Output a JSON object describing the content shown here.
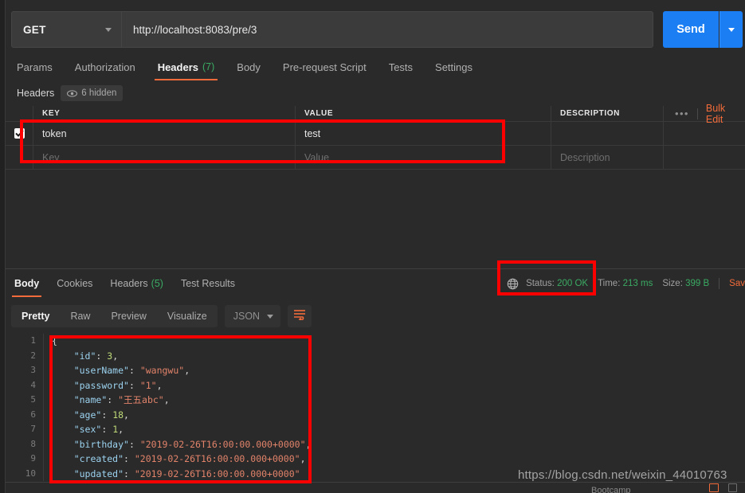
{
  "request": {
    "method": "GET",
    "url": "http://localhost:8083/pre/3",
    "send_label": "Send",
    "tabs": [
      {
        "label": "Params",
        "count": "",
        "active": false
      },
      {
        "label": "Authorization",
        "count": "",
        "active": false
      },
      {
        "label": "Headers",
        "count": "(7)",
        "active": true
      },
      {
        "label": "Body",
        "count": "",
        "active": false
      },
      {
        "label": "Pre-request Script",
        "count": "",
        "active": false
      },
      {
        "label": "Tests",
        "count": "",
        "active": false
      },
      {
        "label": "Settings",
        "count": "",
        "active": false
      }
    ],
    "headers_section": {
      "label": "Headers",
      "hidden_pill": "6 hidden",
      "columns": [
        "KEY",
        "VALUE",
        "DESCRIPTION"
      ],
      "bulk_edit_label": "Bulk Edit",
      "rows": [
        {
          "checked": true,
          "key": "token",
          "value": "test",
          "description": ""
        }
      ],
      "placeholder_row": {
        "key": "Key",
        "value": "Value",
        "description": "Description"
      }
    }
  },
  "response": {
    "tabs": [
      {
        "label": "Body",
        "count": "",
        "active": true
      },
      {
        "label": "Cookies",
        "count": "",
        "active": false
      },
      {
        "label": "Headers",
        "count": "(5)",
        "active": false
      },
      {
        "label": "Test Results",
        "count": "",
        "active": false
      }
    ],
    "status_label": "Status:",
    "status_value": "200 OK",
    "time_label": "Time:",
    "time_value": "213 ms",
    "size_label": "Size:",
    "size_value": "399 B",
    "save_label": "Sav",
    "format_tabs": [
      {
        "label": "Pretty",
        "active": true
      },
      {
        "label": "Raw",
        "active": false
      },
      {
        "label": "Preview",
        "active": false
      },
      {
        "label": "Visualize",
        "active": false
      }
    ],
    "format_select": "JSON",
    "body_lines": [
      {
        "no": "1",
        "segments": [
          {
            "t": "{",
            "c": "p"
          }
        ]
      },
      {
        "no": "2",
        "segments": [
          {
            "t": "    ",
            "c": "p"
          },
          {
            "t": "\"id\"",
            "c": "k"
          },
          {
            "t": ": ",
            "c": "p"
          },
          {
            "t": "3",
            "c": "n"
          },
          {
            "t": ",",
            "c": "p"
          }
        ]
      },
      {
        "no": "3",
        "segments": [
          {
            "t": "    ",
            "c": "p"
          },
          {
            "t": "\"userName\"",
            "c": "k"
          },
          {
            "t": ": ",
            "c": "p"
          },
          {
            "t": "\"wangwu\"",
            "c": "s"
          },
          {
            "t": ",",
            "c": "p"
          }
        ]
      },
      {
        "no": "4",
        "segments": [
          {
            "t": "    ",
            "c": "p"
          },
          {
            "t": "\"password\"",
            "c": "k"
          },
          {
            "t": ": ",
            "c": "p"
          },
          {
            "t": "\"1\"",
            "c": "s"
          },
          {
            "t": ",",
            "c": "p"
          }
        ]
      },
      {
        "no": "5",
        "segments": [
          {
            "t": "    ",
            "c": "p"
          },
          {
            "t": "\"name\"",
            "c": "k"
          },
          {
            "t": ": ",
            "c": "p"
          },
          {
            "t": "\"王五abc\"",
            "c": "s"
          },
          {
            "t": ",",
            "c": "p"
          }
        ]
      },
      {
        "no": "6",
        "segments": [
          {
            "t": "    ",
            "c": "p"
          },
          {
            "t": "\"age\"",
            "c": "k"
          },
          {
            "t": ": ",
            "c": "p"
          },
          {
            "t": "18",
            "c": "n"
          },
          {
            "t": ",",
            "c": "p"
          }
        ]
      },
      {
        "no": "7",
        "segments": [
          {
            "t": "    ",
            "c": "p"
          },
          {
            "t": "\"sex\"",
            "c": "k"
          },
          {
            "t": ": ",
            "c": "p"
          },
          {
            "t": "1",
            "c": "n"
          },
          {
            "t": ",",
            "c": "p"
          }
        ]
      },
      {
        "no": "8",
        "segments": [
          {
            "t": "    ",
            "c": "p"
          },
          {
            "t": "\"birthday\"",
            "c": "k"
          },
          {
            "t": ": ",
            "c": "p"
          },
          {
            "t": "\"2019-02-26T16:00:00.000+0000\"",
            "c": "s"
          },
          {
            "t": ",",
            "c": "p"
          }
        ]
      },
      {
        "no": "9",
        "segments": [
          {
            "t": "    ",
            "c": "p"
          },
          {
            "t": "\"created\"",
            "c": "k"
          },
          {
            "t": ": ",
            "c": "p"
          },
          {
            "t": "\"2019-02-26T16:00:00.000+0000\"",
            "c": "s"
          },
          {
            "t": ",",
            "c": "p"
          }
        ]
      },
      {
        "no": "10",
        "segments": [
          {
            "t": "    ",
            "c": "p"
          },
          {
            "t": "\"updated\"",
            "c": "k"
          },
          {
            "t": ": ",
            "c": "p"
          },
          {
            "t": "\"2019-02-26T16:00:00.000+0000\"",
            "c": "s"
          }
        ]
      }
    ]
  },
  "watermark": "https://blog.csdn.net/weixin_44010763",
  "bootcamp_label": "Bootcamp",
  "colors": {
    "accent_orange": "#f26b3a",
    "send_blue": "#1b7ff3",
    "status_green": "#3aab63",
    "annotation_red": "#ff0000",
    "bg": "#2a2a2a"
  }
}
